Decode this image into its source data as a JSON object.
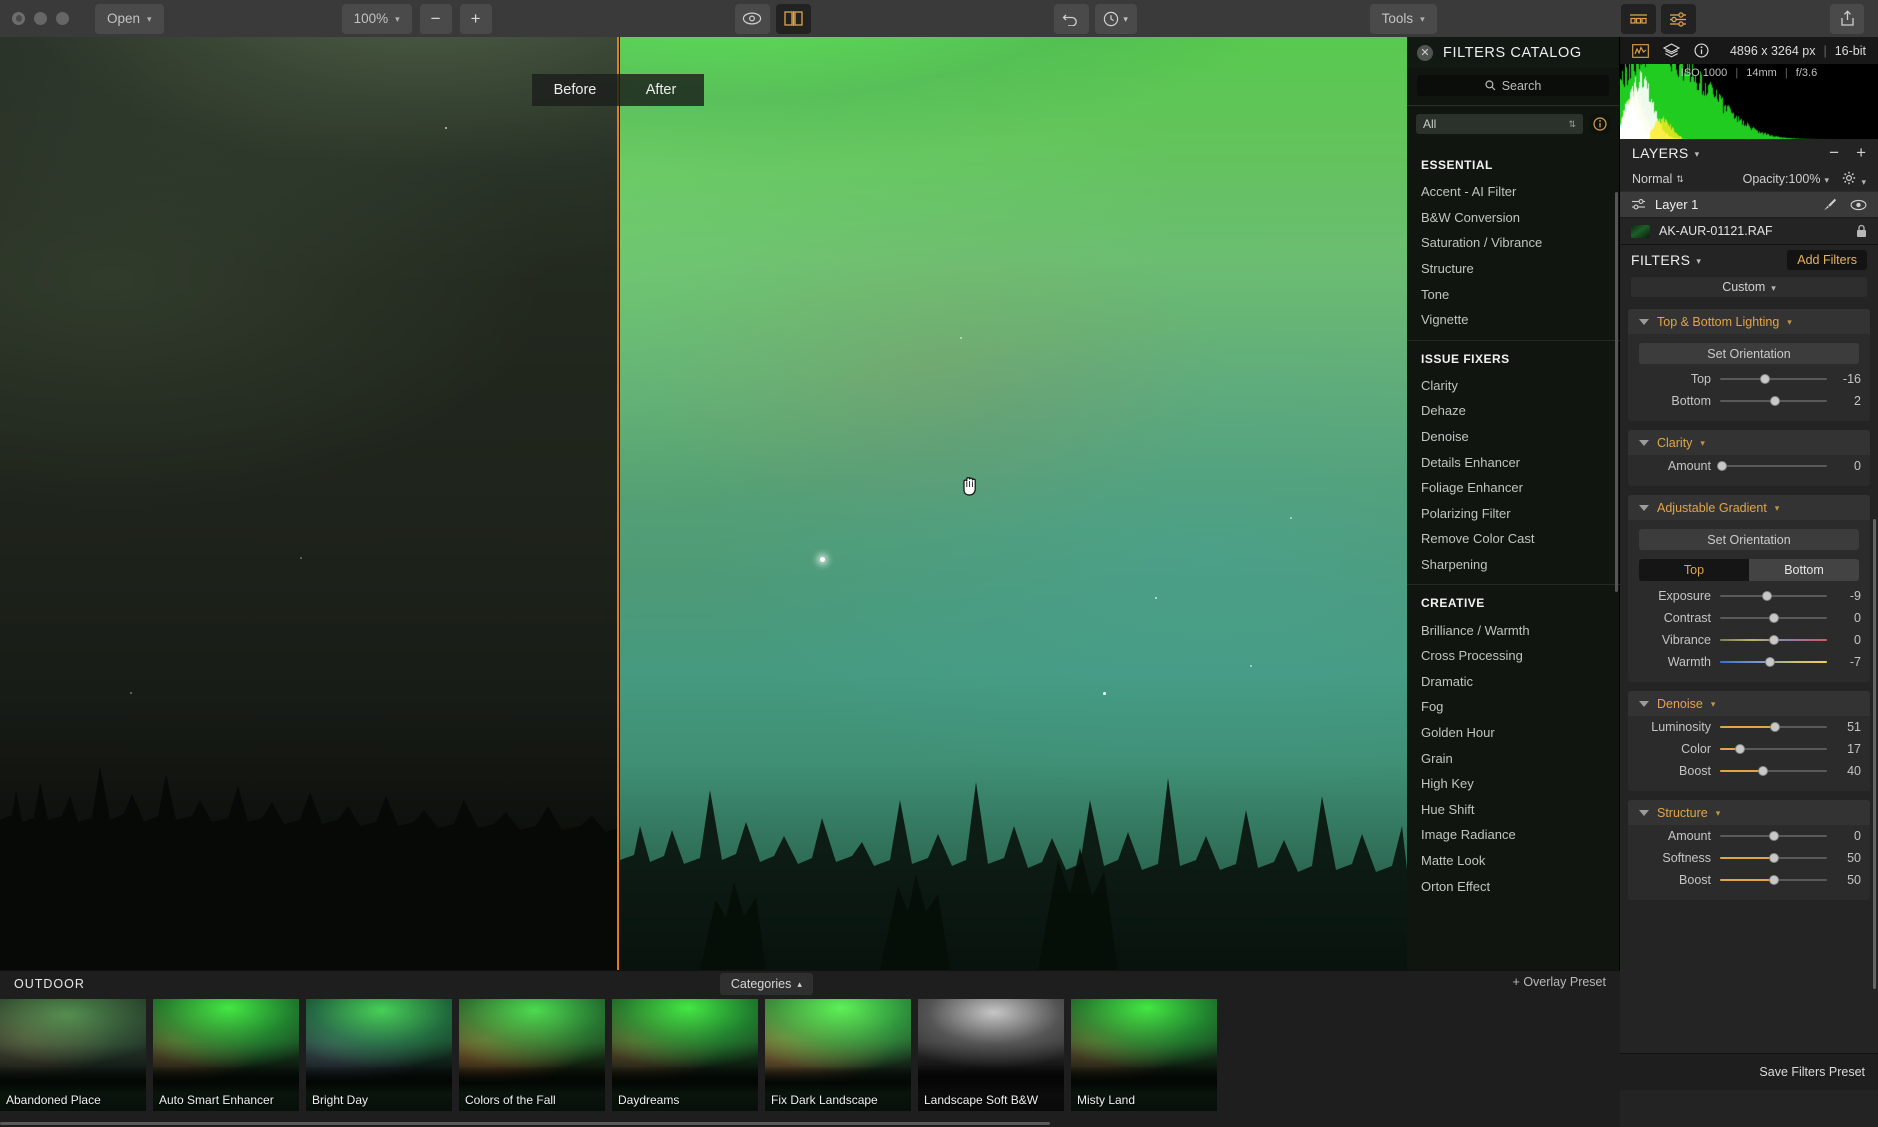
{
  "toolbar": {
    "open_label": "Open",
    "zoom_value": "100%",
    "zoom_out_label": "−",
    "zoom_in_label": "+",
    "eye_icon": "eye-icon",
    "compare_icon": "before-after-split-icon",
    "undo_icon": "undo-icon",
    "history_icon": "history-clock-icon",
    "tools_label": "Tools",
    "presets_panel_icon": "presets-panel-icon",
    "edit_panel_icon": "edit-sliders-panel-icon",
    "share_icon": "share-export-icon"
  },
  "canvas": {
    "before_label": "Before",
    "after_label": "After",
    "cursor_icon": "open-hand-cursor"
  },
  "catalog": {
    "close_icon": "close-icon",
    "title": "FILTERS CATALOG",
    "search_placeholder": "Search",
    "search_icon": "search-icon",
    "category_value": "All",
    "info_icon": "info-icon",
    "groups": [
      {
        "title": "ESSENTIAL",
        "items": [
          "Accent - AI Filter",
          "B&W Conversion",
          "Saturation / Vibrance",
          "Structure",
          "Tone",
          "Vignette"
        ]
      },
      {
        "title": "ISSUE FIXERS",
        "items": [
          "Clarity",
          "Dehaze",
          "Denoise",
          "Details Enhancer",
          "Foliage Enhancer",
          "Polarizing Filter",
          "Remove Color Cast",
          "Sharpening"
        ]
      },
      {
        "title": "CREATIVE",
        "items": [
          "Brilliance / Warmth",
          "Cross Processing",
          "Dramatic",
          "Fog",
          "Golden Hour",
          "Grain",
          "High Key",
          "Hue Shift",
          "Image Radiance",
          "Matte Look",
          "Orton Effect"
        ]
      }
    ]
  },
  "right": {
    "histogram_icon": "histogram-icon",
    "layers_icon": "layers-stack-icon",
    "info_icon": "info-icon",
    "dimensions": "4896 x 3264 px",
    "bit_depth": "16-bit",
    "exif": {
      "iso": "ISO 1000",
      "focal": "14mm",
      "aperture": "f/3.6"
    },
    "layers": {
      "title": "LAYERS",
      "remove_label": "−",
      "add_label": "+",
      "blend_mode": "Normal",
      "opacity_label": "Opacity:",
      "opacity_value": "100%",
      "gear_icon": "gear-icon",
      "layer_name": "Layer 1",
      "brush_icon": "brush-icon",
      "eye_icon": "eye-visibility-icon",
      "adjust_icon": "adjustments-icon"
    },
    "file": {
      "name": "AK-AUR-01121.RAF",
      "lock_icon": "lock-icon"
    },
    "filters": {
      "title": "FILTERS",
      "add_label": "Add Filters",
      "preset_value": "Custom",
      "save_label": "Save Filters Preset"
    },
    "fx": [
      {
        "name": "Top & Bottom Lighting",
        "button": "Set Orientation",
        "sliders": [
          {
            "label": "Top",
            "value": "-16",
            "pos": 42,
            "style": "plain"
          },
          {
            "label": "Bottom",
            "value": "2",
            "pos": 51,
            "style": "plain"
          }
        ]
      },
      {
        "name": "Clarity",
        "sliders": [
          {
            "label": "Amount",
            "value": "0",
            "pos": 2,
            "style": "plain"
          }
        ]
      },
      {
        "name": "Adjustable Gradient",
        "button": "Set Orientation",
        "toggle": {
          "on": "Top",
          "off": "Bottom"
        },
        "sliders": [
          {
            "label": "Exposure",
            "value": "-9",
            "pos": 44,
            "style": "plain"
          },
          {
            "label": "Contrast",
            "value": "0",
            "pos": 50,
            "style": "plain"
          },
          {
            "label": "Vibrance",
            "value": "0",
            "pos": 50,
            "style": "vibrance"
          },
          {
            "label": "Warmth",
            "value": "-7",
            "pos": 47,
            "style": "warmth"
          }
        ]
      },
      {
        "name": "Denoise",
        "sliders": [
          {
            "label": "Luminosity",
            "value": "51",
            "pos": 51,
            "style": "fill"
          },
          {
            "label": "Color",
            "value": "17",
            "pos": 19,
            "style": "fill"
          },
          {
            "label": "Boost",
            "value": "40",
            "pos": 40,
            "style": "fill"
          }
        ]
      },
      {
        "name": "Structure",
        "sliders": [
          {
            "label": "Amount",
            "value": "0",
            "pos": 50,
            "style": "plain"
          },
          {
            "label": "Softness",
            "value": "50",
            "pos": 50,
            "style": "fill"
          },
          {
            "label": "Boost",
            "value": "50",
            "pos": 50,
            "style": "fill"
          }
        ]
      }
    ]
  },
  "presets": {
    "category_title": "OUTDOOR",
    "categories_label": "Categories",
    "overlay_label": "+ Overlay Preset",
    "items": [
      {
        "name": "Abandoned Place",
        "style": "muted"
      },
      {
        "name": "Auto Smart Enhancer",
        "style": "bright"
      },
      {
        "name": "Bright Day",
        "style": "cool"
      },
      {
        "name": "Colors of the Fall",
        "style": "warm"
      },
      {
        "name": "Daydreams",
        "style": "bright"
      },
      {
        "name": "Fix Dark Landscape",
        "style": "lifted"
      },
      {
        "name": "Landscape Soft B&W",
        "style": "bw"
      },
      {
        "name": "Misty Land",
        "style": "bright"
      }
    ]
  },
  "colors": {
    "accent": "#e0a549",
    "split_line": "#e8791e",
    "panel_bg": "#242424",
    "catalog_bg": "#101510"
  }
}
